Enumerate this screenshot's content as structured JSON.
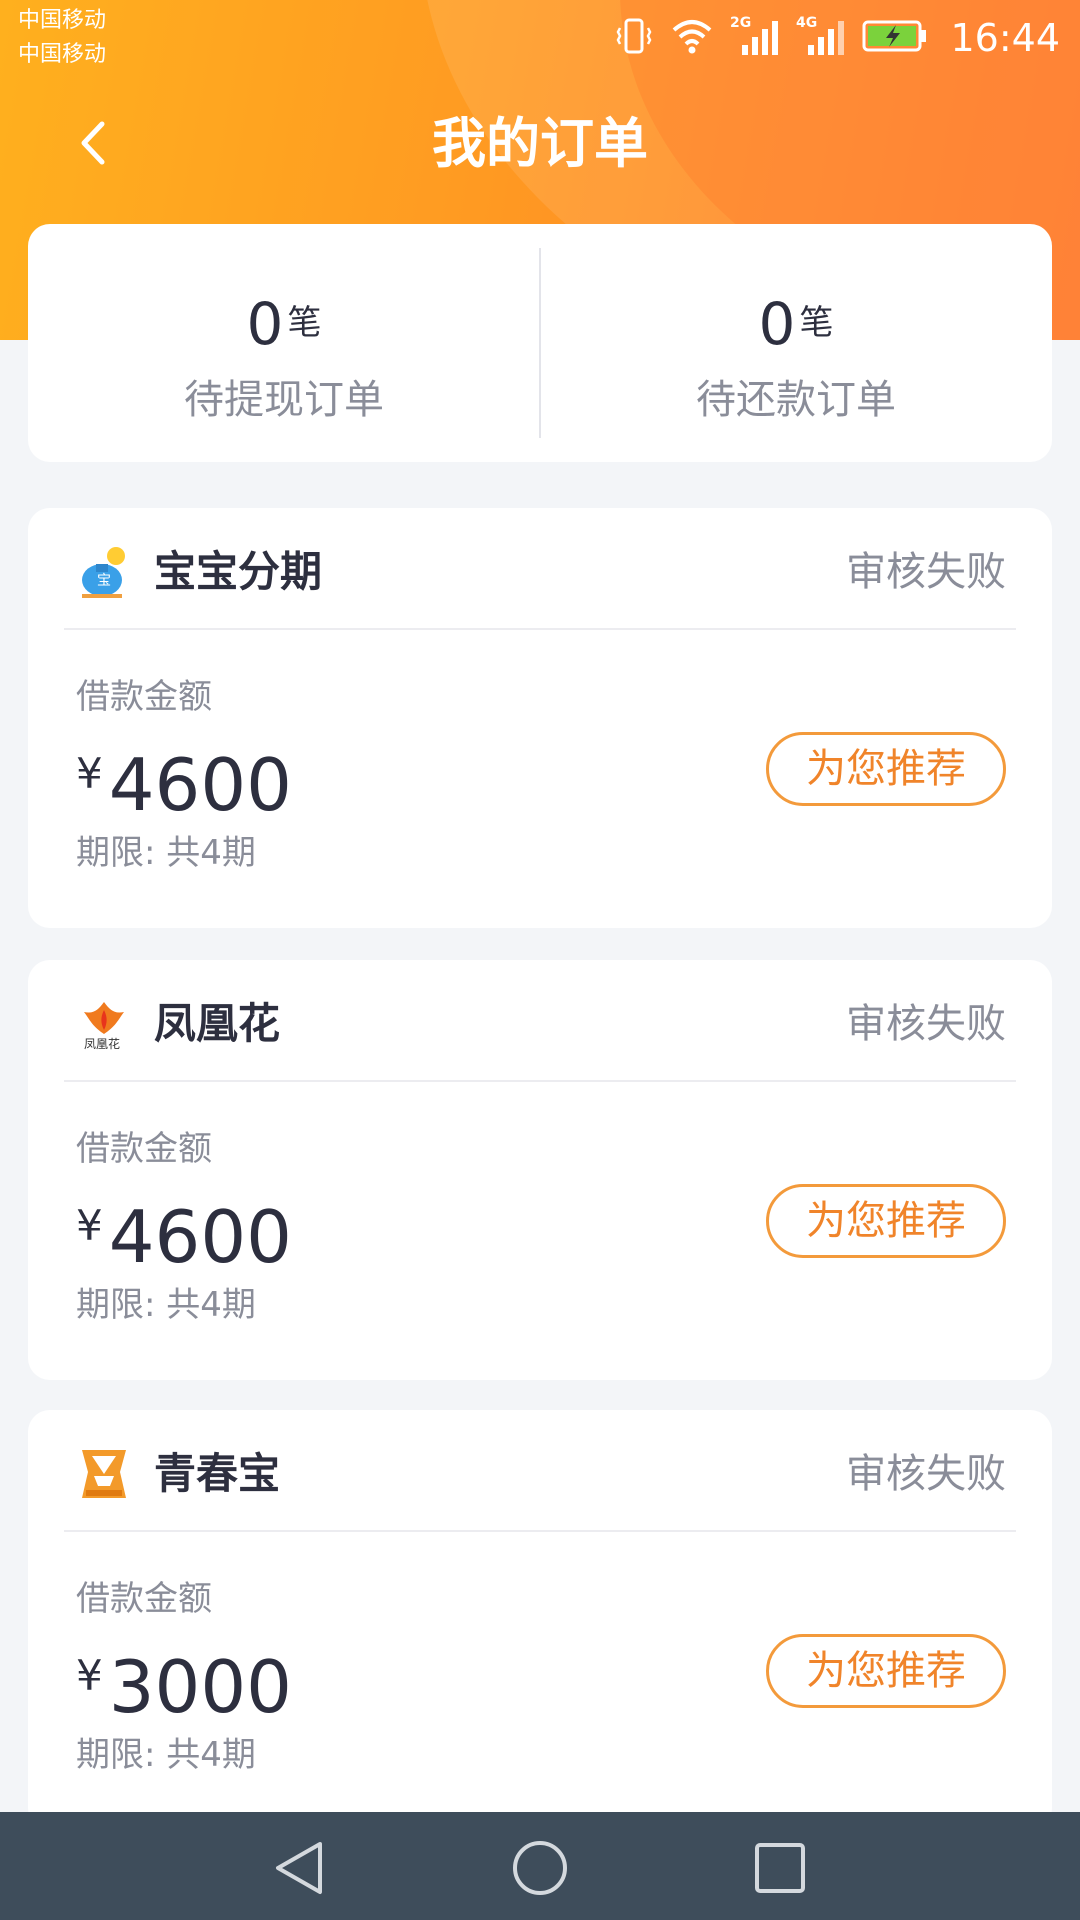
{
  "status_bar": {
    "carrier_1": "中国移动",
    "carrier_2": "中国移动",
    "network_2g": "2G",
    "network_4g": "4G",
    "time": "16:44",
    "icons": [
      "vibrate-icon",
      "wifi-icon",
      "signal-2g-icon",
      "signal-4g-icon",
      "battery-charging-icon"
    ]
  },
  "header": {
    "title": "我的订单",
    "back_icon": "chevron-left-icon"
  },
  "summary": {
    "left": {
      "count": "0",
      "unit": "笔",
      "label": "待提现订单"
    },
    "right": {
      "count": "0",
      "unit": "笔",
      "label": "待还款订单"
    }
  },
  "orders": [
    {
      "name": "宝宝分期",
      "status": "审核失败",
      "amount_label": "借款金额",
      "currency": "¥",
      "amount": "4600",
      "term": "期限: 共4期",
      "action": "为您推荐",
      "logo": "baobao-logo"
    },
    {
      "name": "凤凰花",
      "status": "审核失败",
      "amount_label": "借款金额",
      "currency": "¥",
      "amount": "4600",
      "term": "期限: 共4期",
      "action": "为您推荐",
      "logo": "phoenix-logo"
    },
    {
      "name": "青春宝",
      "status": "审核失败",
      "amount_label": "借款金额",
      "currency": "¥",
      "amount": "3000",
      "term": "期限: 共4期",
      "action": "为您推荐",
      "logo": "qingchunbao-logo"
    }
  ],
  "theme": {
    "header_gradient_start": "#ffb01e",
    "header_gradient_end": "#ff7a2a",
    "accent": "#f0842a",
    "nav_bar": "#3e4d5b"
  },
  "system_nav": [
    "back-triangle-icon",
    "home-circle-icon",
    "recents-square-icon"
  ]
}
